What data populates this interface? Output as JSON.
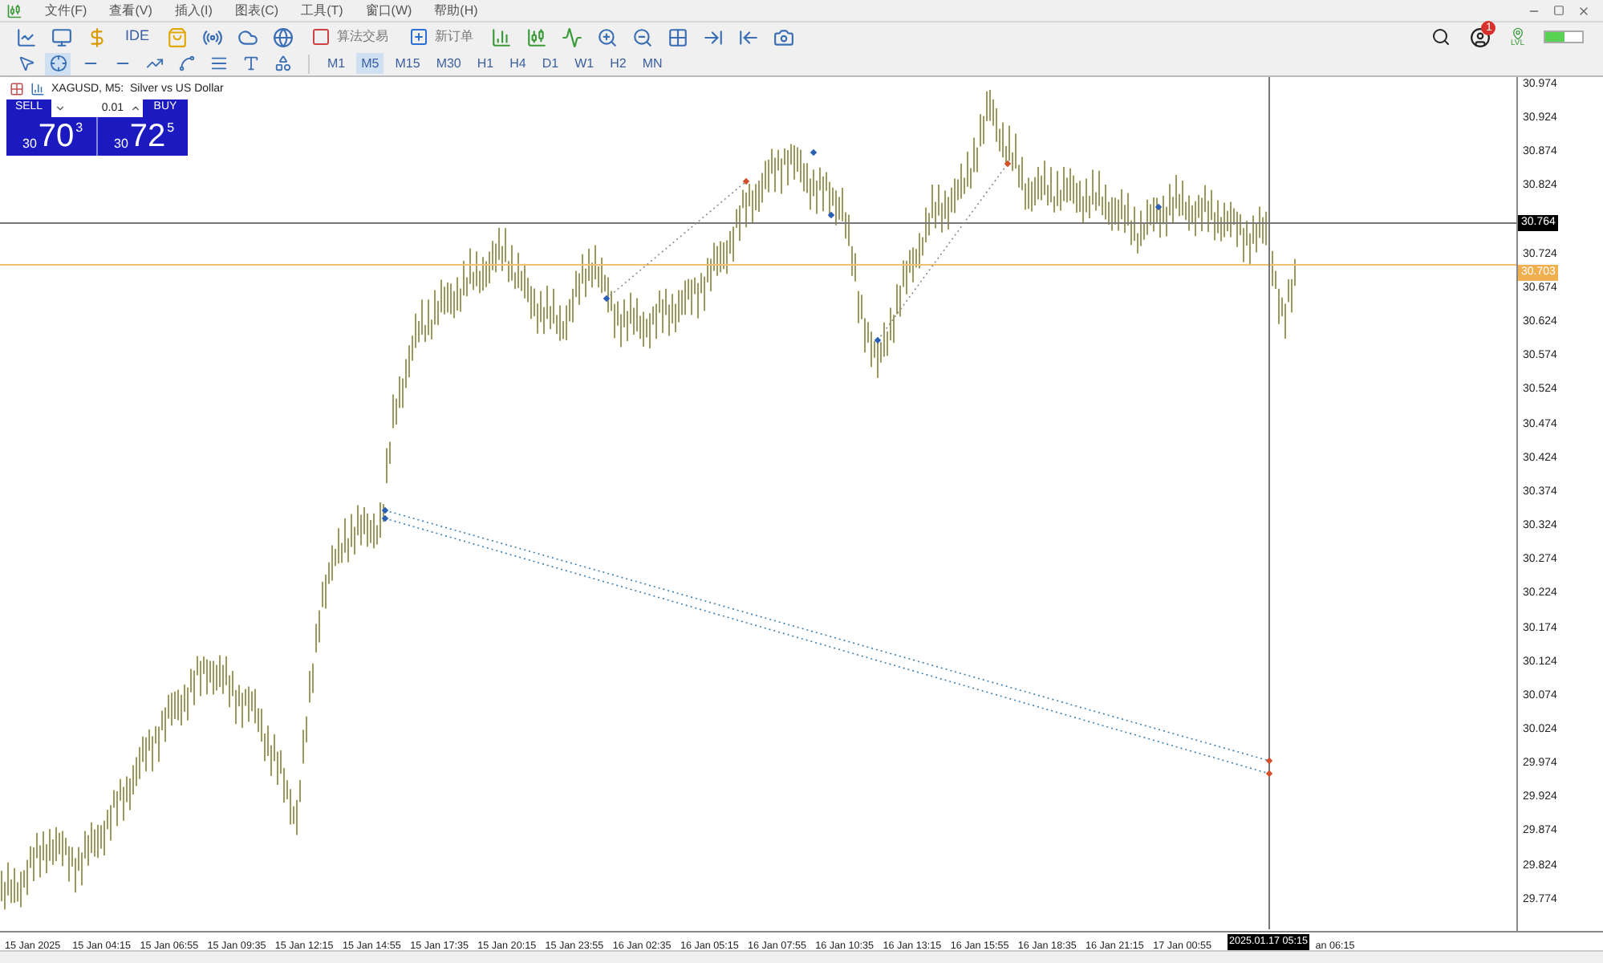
{
  "menu": [
    {
      "label": "文件(F)"
    },
    {
      "label": "查看(V)"
    },
    {
      "label": "插入(I)"
    },
    {
      "label": "图表(C)"
    },
    {
      "label": "工具(T)"
    },
    {
      "label": "窗口(W)"
    },
    {
      "label": "帮助(H)"
    }
  ],
  "toolbar": [
    {
      "kind": "icon"
    },
    {
      "kind": "icon"
    },
    {
      "kind": "icon"
    },
    {
      "kind": "text",
      "label": "IDE"
    },
    {
      "kind": "icon"
    },
    {
      "kind": "icon"
    },
    {
      "kind": "icon"
    },
    {
      "kind": "icon"
    },
    {
      "kind": "labeled",
      "label": "算法交易"
    },
    {
      "kind": "labeled",
      "label": "新订单"
    },
    {
      "kind": "icon"
    },
    {
      "kind": "icon"
    },
    {
      "kind": "icon"
    },
    {
      "kind": "icon"
    },
    {
      "kind": "icon"
    },
    {
      "kind": "icon"
    },
    {
      "kind": "icon"
    },
    {
      "kind": "icon"
    },
    {
      "kind": "icon"
    }
  ],
  "tools": [
    {
      "selected": false
    },
    {
      "selected": true
    },
    {
      "selected": false
    },
    {
      "selected": false
    },
    {
      "selected": false
    },
    {
      "selected": false
    },
    {
      "selected": false
    },
    {
      "selected": false
    },
    {
      "selected": false
    }
  ],
  "timeframes": [
    {
      "label": "M1",
      "selected": false
    },
    {
      "label": "M5",
      "selected": true
    },
    {
      "label": "M15",
      "selected": false
    },
    {
      "label": "M30",
      "selected": false
    },
    {
      "label": "H1",
      "selected": false
    },
    {
      "label": "H4",
      "selected": false
    },
    {
      "label": "D1",
      "selected": false
    },
    {
      "label": "W1",
      "selected": false
    },
    {
      "label": "H2",
      "selected": false
    },
    {
      "label": "MN",
      "selected": false
    }
  ],
  "notifications": {
    "count": "1"
  },
  "connection": {
    "label": "LVL"
  },
  "chart": {
    "title": "XAGUSD, M5:  Silver vs US Dollar",
    "trade_panel": {
      "sell_label": "SELL",
      "buy_label": "BUY",
      "volume": "0.01",
      "sell": {
        "prefix": "30",
        "big": "70",
        "sup": "3"
      },
      "buy": {
        "prefix": "30",
        "big": "72",
        "sup": "5"
      }
    },
    "price_axis": [
      "30.974",
      "30.924",
      "30.874",
      "30.824",
      "30.724",
      "30.674",
      "30.624",
      "30.574",
      "30.524",
      "30.474",
      "30.424",
      "30.374",
      "30.324",
      "30.274",
      "30.224",
      "30.174",
      "30.124",
      "30.074",
      "30.024",
      "29.974",
      "29.924",
      "29.874",
      "29.824",
      "29.774"
    ],
    "crosshair_price": "30.764",
    "last_price": "30.703",
    "time_axis": [
      "15 Jan 2025",
      "15 Jan 04:15",
      "15 Jan 06:55",
      "15 Jan 09:35",
      "15 Jan 12:15",
      "15 Jan 14:55",
      "15 Jan 17:35",
      "15 Jan 20:15",
      "15 Jan 23:55",
      "16 Jan 02:35",
      "16 Jan 05:15",
      "16 Jan 07:55",
      "16 Jan 10:35",
      "16 Jan 13:15",
      "16 Jan 15:55",
      "16 Jan 18:35",
      "16 Jan 21:15",
      "17 Jan 00:55",
      "an 06:15"
    ],
    "crosshair_time": "2025.01.17 05:15"
  }
}
